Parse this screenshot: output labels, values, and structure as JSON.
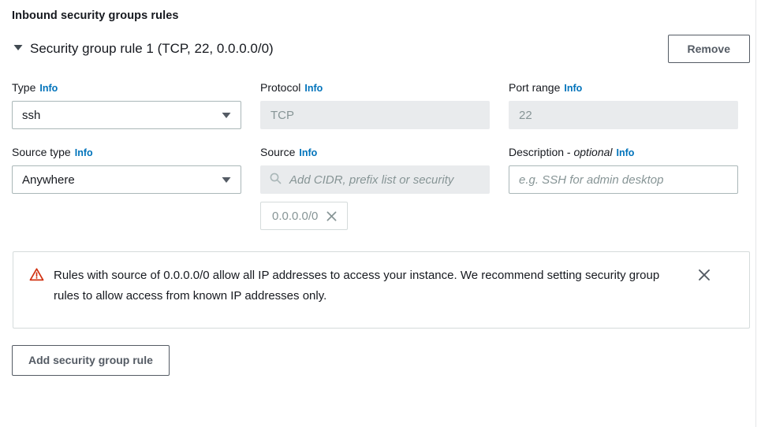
{
  "section": {
    "title": "Inbound security groups rules"
  },
  "rule": {
    "caret_icon": "caret-down-icon",
    "title": "Security group rule 1 (TCP, 22, 0.0.0.0/0)",
    "remove_label": "Remove"
  },
  "fields": {
    "type": {
      "label": "Type",
      "info": "Info",
      "value": "ssh",
      "caret_icon": "chevron-down-icon"
    },
    "protocol": {
      "label": "Protocol",
      "info": "Info",
      "value": "TCP"
    },
    "port_range": {
      "label": "Port range",
      "info": "Info",
      "value": "22"
    },
    "source_type": {
      "label": "Source type",
      "info": "Info",
      "value": "Anywhere",
      "caret_icon": "chevron-down-icon"
    },
    "source": {
      "label": "Source",
      "info": "Info",
      "search_icon": "search-icon",
      "placeholder": "Add CIDR, prefix list or security",
      "token": {
        "label": "0.0.0.0/0",
        "dismiss_icon": "close-icon"
      }
    },
    "description": {
      "label": "Description -",
      "optional": "optional",
      "info": "Info",
      "placeholder": "e.g. SSH for admin desktop",
      "value": ""
    }
  },
  "alert": {
    "icon": "warning-triangle-icon",
    "text": "Rules with source of 0.0.0.0/0 allow all IP addresses to access your instance. We recommend setting security group rules to allow access from known IP addresses only.",
    "dismiss_icon": "close-icon"
  },
  "footer": {
    "add_rule_label": "Add security group rule"
  },
  "colors": {
    "link": "#0073bb",
    "warning": "#d13212",
    "button_text": "#545b64",
    "disabled_bg": "#e9ebed",
    "disabled_text": "#879596",
    "border": "#aab7b8",
    "text": "#16191f"
  }
}
